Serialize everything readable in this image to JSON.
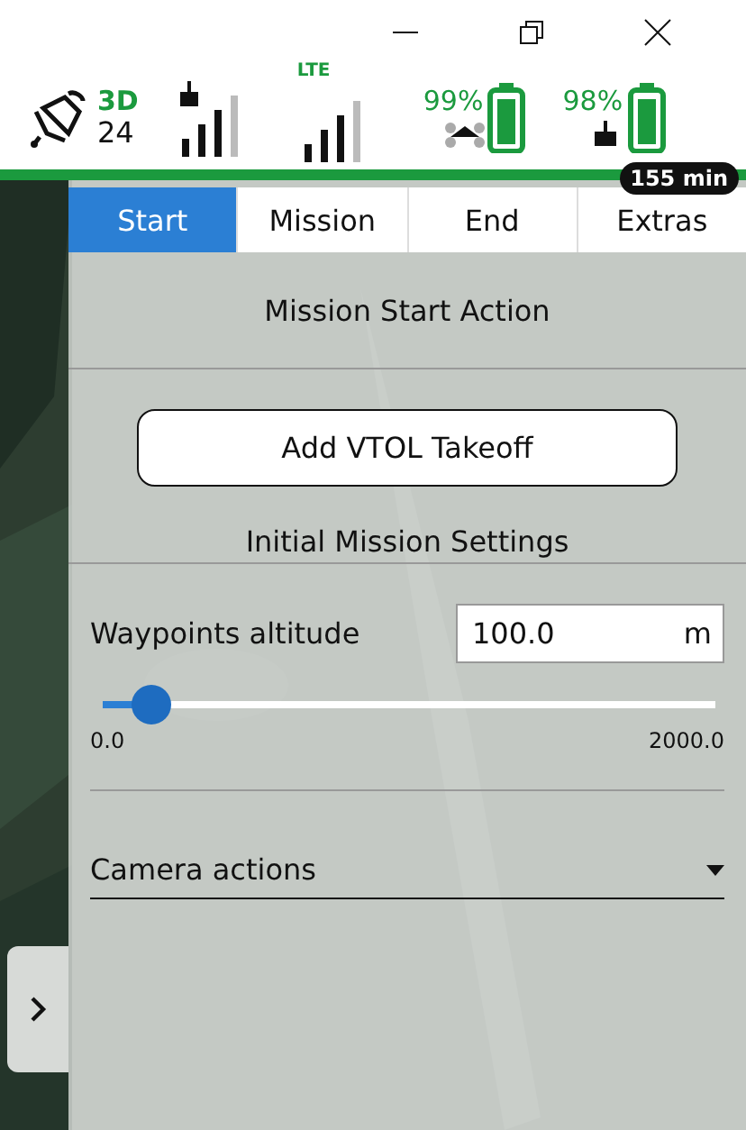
{
  "status": {
    "gps_fix": "3D",
    "satellites": "24",
    "link_label": "LTE",
    "vehicle_battery": "99%",
    "controller_battery": "98%",
    "flight_time": "155 min"
  },
  "tabs": [
    {
      "label": "Start",
      "selected": true
    },
    {
      "label": "Mission",
      "selected": false
    },
    {
      "label": "End",
      "selected": false
    },
    {
      "label": "Extras",
      "selected": false
    }
  ],
  "start_section": {
    "title": "Mission Start Action",
    "button": "Add VTOL Takeoff",
    "settings_title": "Initial Mission Settings"
  },
  "altitude": {
    "label": "Waypoints altitude",
    "value": "100.0",
    "unit": "m",
    "level": 0.05,
    "min": "0.0",
    "max": "2000.0"
  },
  "camera": {
    "label": "Camera actions"
  }
}
